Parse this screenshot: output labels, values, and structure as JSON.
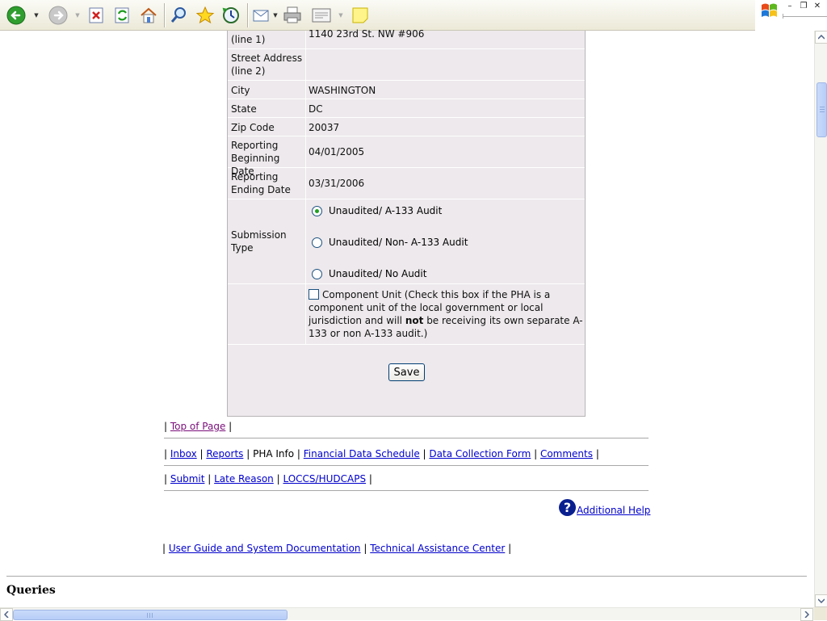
{
  "toolbar": {
    "buttons": [
      "back-icon",
      "forward-icon",
      "stop-icon",
      "refresh-icon",
      "home-icon",
      "search-icon",
      "favorites-icon",
      "history-icon",
      "mail-icon",
      "print-icon",
      "edit-icon",
      "note-icon"
    ]
  },
  "form": {
    "rows": [
      {
        "label": "(line 1)",
        "value": "1140 23rd St. NW #906"
      },
      {
        "label": "Street Address (line 2)",
        "value": ""
      },
      {
        "label": "City",
        "value": "WASHINGTON"
      },
      {
        "label": "State",
        "value": "DC"
      },
      {
        "label": "Zip Code",
        "value": "20037"
      },
      {
        "label": "Reporting Beginning Date",
        "value": "04/01/2005"
      },
      {
        "label": "Reporting Ending Date",
        "value": "03/31/2006"
      }
    ],
    "submission_type": {
      "label": "Submission Type",
      "options": [
        "Unaudited/ A-133 Audit",
        "Unaudited/ Non- A-133 Audit",
        "Unaudited/ No Audit"
      ],
      "selected": "Unaudited/ A-133 Audit"
    },
    "component_unit": {
      "text_before": "Component Unit (Check this box if the PHA is a component unit of the local government or local jurisdiction and will ",
      "bold": "not",
      "text_after": " be receiving its own separate A-133 or non A-133 audit.)",
      "checked": false
    },
    "save_label": "Save"
  },
  "top_nav": {
    "link": "Top of Page"
  },
  "nav1": {
    "inbox": "Inbox",
    "reports": "Reports",
    "pha_info": "PHA Info",
    "fds": "Financial Data Schedule",
    "dcf": "Data Collection Form",
    "comments": "Comments"
  },
  "nav2": {
    "submit": "Submit",
    "late_reason": "Late Reason",
    "loccs": "LOCCS/HUDCAPS"
  },
  "help": {
    "label": "Additional Help"
  },
  "docs": {
    "guide": "User Guide and System Documentation",
    "tac": "Technical Assistance Center"
  },
  "queries": {
    "heading": "Queries"
  },
  "colors": {
    "link": "#0000cc",
    "visited": "#7a0f7a",
    "panel_bg": "#ede9ec",
    "help_icon": "#0a1f8f"
  }
}
